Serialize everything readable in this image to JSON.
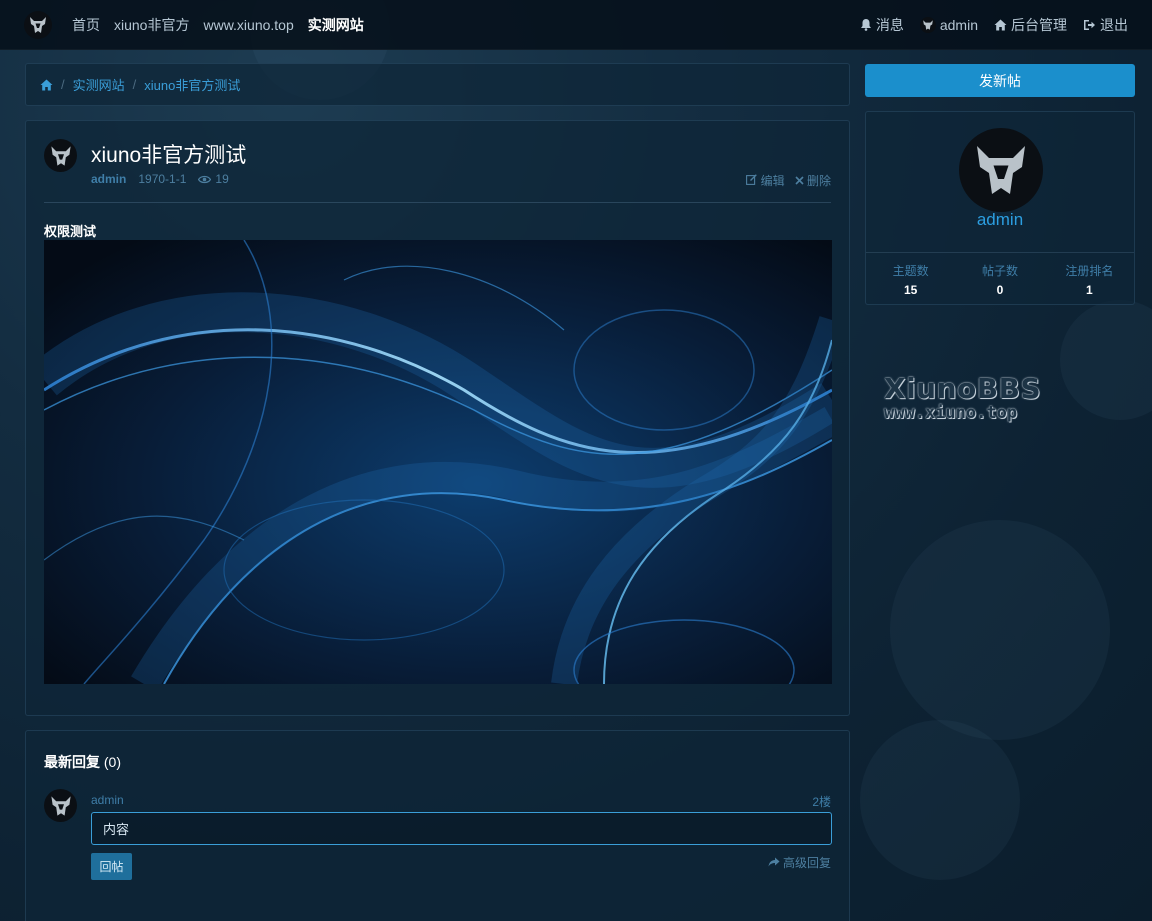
{
  "navbar": {
    "links": [
      "首页",
      "xiuno非官方",
      "www.xiuno.top",
      "实测网站"
    ],
    "active_link": "实测网站",
    "messages": "消息",
    "user": "admin",
    "admin_panel": "后台管理",
    "logout": "退出"
  },
  "breadcrumb": {
    "items": [
      "实测网站",
      "xiuno非官方测试"
    ]
  },
  "post": {
    "title": "xiuno非官方测试",
    "author": "admin",
    "date": "1970-1-1",
    "views": "19",
    "edit": "编辑",
    "delete": "删除",
    "content_label": "权限测试"
  },
  "reply": {
    "heading": "最新回复",
    "count": "(0)",
    "user": "admin",
    "floor": "2楼",
    "input_value": "内容",
    "submit": "回帖",
    "advanced": "高级回复"
  },
  "sidebar": {
    "new_thread": "发新帖",
    "username": "admin",
    "stats": [
      {
        "label": "主题数",
        "value": "15"
      },
      {
        "label": "帖子数",
        "value": "0"
      },
      {
        "label": "注册排名",
        "value": "1"
      }
    ],
    "watermark_line1": "XiunoBBS",
    "watermark_line2": "www.xiuno.top"
  },
  "icons": {
    "home": "home-icon",
    "bell": "bell-icon",
    "eye": "eye-icon",
    "edit": "edit-icon",
    "delete": "close-icon",
    "share": "reply-icon",
    "logout": "logout-icon"
  },
  "colors": {
    "accent": "#1b8fcc",
    "link": "#3a9ed8"
  }
}
